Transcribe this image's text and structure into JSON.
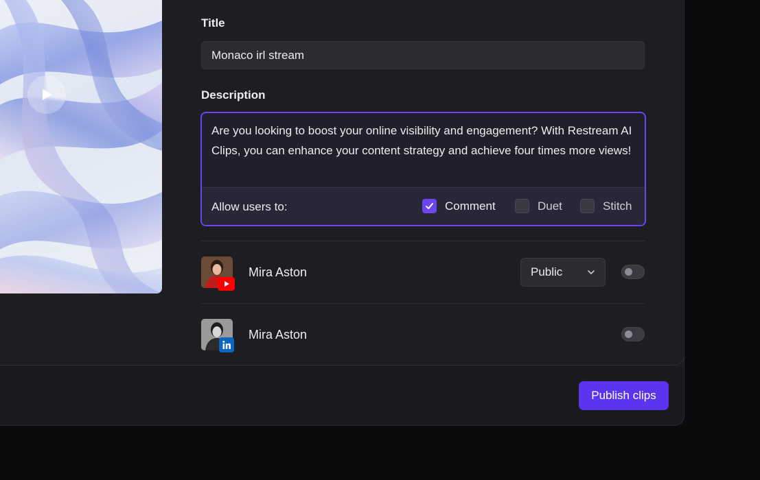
{
  "form": {
    "title_label": "Title",
    "title_value": "Monaco irl stream",
    "description_label": "Description",
    "description_value": "Are you looking to boost your online visibility and engagement? With Restream AI Clips, you can enhance your content strategy and achieve four times more views!",
    "allow_label": "Allow users to:",
    "options": [
      {
        "label": "Comment",
        "checked": true
      },
      {
        "label": "Duet",
        "checked": false
      },
      {
        "label": "Stitch",
        "checked": false
      }
    ]
  },
  "accounts": [
    {
      "name": "Mira Aston",
      "platform": "youtube-icon",
      "visibility": "Public",
      "enabled": false
    },
    {
      "name": "Mira Aston",
      "platform": "linkedin-icon",
      "enabled": false
    }
  ],
  "actions": {
    "publish_label": "Publish clips"
  },
  "colors": {
    "accent": "#5b34f0",
    "focus_border": "#6a45f0",
    "panel": "#1e1e22",
    "youtube": "#ff0000",
    "linkedin": "#0a66c2"
  }
}
